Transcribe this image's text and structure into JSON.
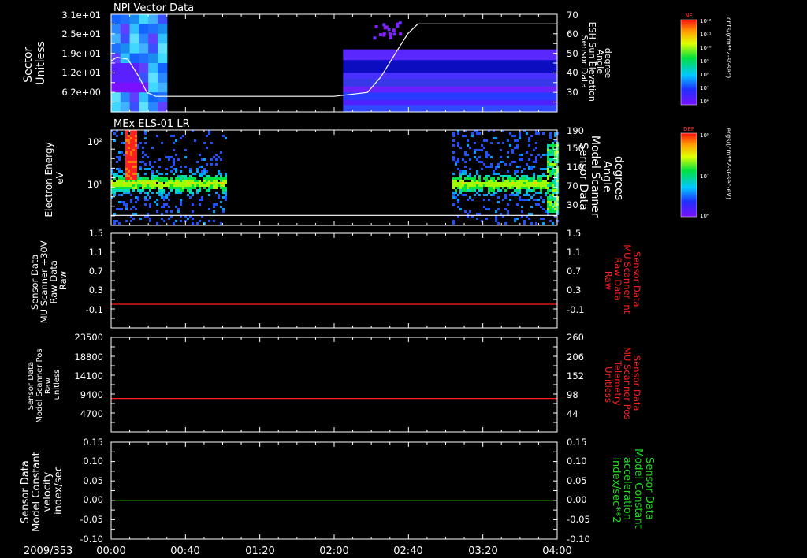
{
  "date_label": "2009/353",
  "time_ticks": [
    "00:00",
    "00:40",
    "01:20",
    "02:00",
    "02:40",
    "03:20",
    "04:00"
  ],
  "colors": {
    "red": "#ff2020",
    "green": "#22dd22",
    "white": "#ffffff"
  },
  "colorbars": [
    {
      "tag": "NF",
      "unit": "cnts/(cm**2-sr-sec)",
      "ticks": [
        "10¹²",
        "10¹¹",
        "10¹⁰",
        "10⁹",
        "10⁸",
        "10⁷",
        "10⁶"
      ]
    },
    {
      "tag": "DEF",
      "unit": "ergs/(cm**2-sr-sec-eV)",
      "ticks": [
        "10⁸",
        "10⁷",
        "10⁶"
      ]
    }
  ],
  "chart_data": [
    {
      "type": "heatmap",
      "title": "NPI Vector Data",
      "ylabel_lines": [
        "Sector",
        "Unitless"
      ],
      "y_ticks": [
        "3.1e+01",
        "2.5e+01",
        "1.9e+01",
        "1.2e+01",
        "6.2e+00"
      ],
      "y2label_lines": [
        "Sensor Data",
        "ESH Sun Elevation",
        "Angle",
        "degree"
      ],
      "y2_ticks": [
        "70",
        "60",
        "50",
        "40",
        "30"
      ],
      "y2lim": [
        20,
        70
      ],
      "overlay": {
        "t_hours": [
          0.0,
          0.05,
          0.15,
          0.25,
          0.32,
          0.4,
          0.5,
          2.0,
          2.3,
          2.42,
          2.55,
          2.66,
          2.75,
          4.0
        ],
        "values": [
          46,
          48,
          47,
          38,
          30,
          28,
          28,
          28,
          30,
          38,
          50,
          60,
          65,
          65
        ]
      },
      "data_segments": [
        {
          "start_hours": 0.0,
          "end_hours": 0.5
        },
        {
          "start_hours": 2.08,
          "end_hours": 4.0
        }
      ]
    },
    {
      "type": "heatmap",
      "title": "MEx ELS-01 LR",
      "ylabel_lines": [
        "Electron Energy",
        "eV"
      ],
      "y_ticks": [
        "10²",
        "10¹"
      ],
      "y2label_lines": [
        "Sensor Data",
        "Model Scanner",
        "Angle",
        "degrees"
      ],
      "y2_ticks": [
        "190",
        "150",
        "110",
        "70",
        "30"
      ],
      "y2lim": [
        0,
        190
      ],
      "overlay": {
        "t_hours": [
          0.0,
          4.0
        ],
        "values": [
          20,
          20
        ]
      },
      "data_segments": [
        {
          "start_hours": 0.0,
          "end_hours": 1.03
        },
        {
          "start_hours": 3.06,
          "end_hours": 4.0
        }
      ]
    },
    {
      "type": "line",
      "ylabel_lines": [
        "Sensor Data",
        "MU Scanner +30V",
        "Raw Data",
        "Raw"
      ],
      "y_ticks": [
        "1.5",
        "1.1",
        "0.7",
        "0.3",
        "-0.1"
      ],
      "ylim": [
        -0.5,
        1.5
      ],
      "y2label_lines": [
        "Sensor Data",
        "MU Scanner Int",
        "Raw Data",
        "Raw"
      ],
      "y2_ticks": [
        "1.5",
        "1.1",
        "0.7",
        "0.3",
        "-0.1"
      ],
      "series": [
        {
          "x_hours": [
            0,
            4
          ],
          "values": [
            0.0,
            0.0
          ],
          "color": "#ff2020"
        }
      ]
    },
    {
      "type": "line",
      "ylabel_lines": [
        "Sensor Data",
        "Model Scanner Pos",
        "Raw",
        "unitless"
      ],
      "y_ticks": [
        "23500",
        "18800",
        "14100",
        "9400",
        "4700"
      ],
      "ylim": [
        0,
        23500
      ],
      "y2label_lines": [
        "Sensor Data",
        "MU Scanner Pos",
        "Telemetry",
        "Unitless"
      ],
      "y2_ticks": [
        "260",
        "206",
        "152",
        "98",
        "44"
      ],
      "series": [
        {
          "x_hours": [
            0,
            4
          ],
          "values": [
            8300,
            8300
          ],
          "color": "#ff2020"
        }
      ]
    },
    {
      "type": "line",
      "ylabel_lines": [
        "Sensor Data",
        "Model Constant",
        "velocity",
        "index/sec"
      ],
      "y_ticks": [
        "0.15",
        "0.10",
        "0.05",
        "0.00",
        "-0.05",
        "-0.10"
      ],
      "ylim": [
        -0.1,
        0.15
      ],
      "y2label_lines": [
        "Sensor Data",
        "Model Constant",
        "acceleration",
        "index/sec**2"
      ],
      "y2_ticks": [
        "0.15",
        "0.10",
        "0.05",
        "0.00",
        "-0.05",
        "-0.10"
      ],
      "series": [
        {
          "x_hours": [
            0,
            4
          ],
          "values": [
            0.0,
            0.0
          ],
          "color": "#22dd22"
        }
      ]
    }
  ]
}
